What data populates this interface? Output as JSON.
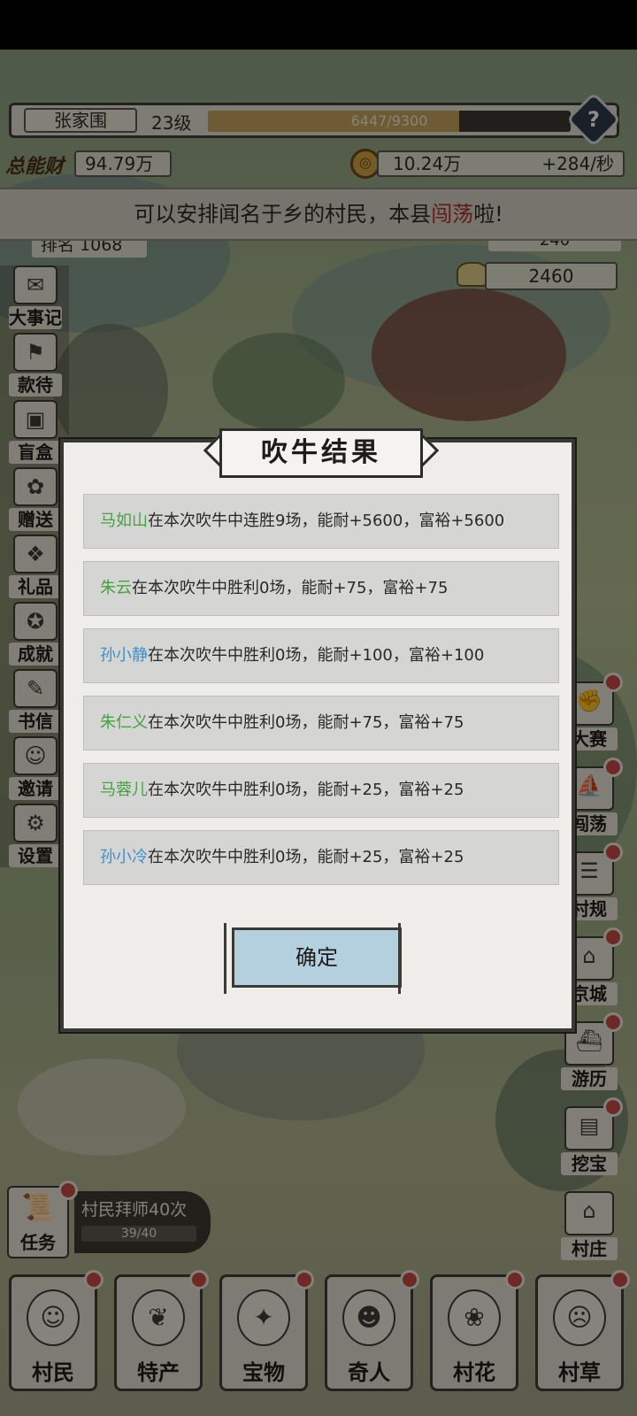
{
  "hud": {
    "village_name": "张家围",
    "level": "23级",
    "xp_text": "6447/9300",
    "xp_progress": 0.693,
    "help_label": "?",
    "power_label": "总能财",
    "power_value": "94.79万",
    "coin_amount": "10.24万",
    "coin_rate": "+284/秒",
    "rank_text": "排名 1068",
    "small_value": "240",
    "ingot_value": "2460"
  },
  "notice": {
    "prefix": "可以安排闻名于乡的村民，本县",
    "highlight": "闯荡",
    "suffix": "啦!"
  },
  "left_menu": [
    {
      "label": "大事记",
      "icon": "scroll-icon"
    },
    {
      "label": "款待",
      "icon": "hospitality-icon"
    },
    {
      "label": "盲盒",
      "icon": "box-icon"
    },
    {
      "label": "赠送",
      "icon": "gift-icon"
    },
    {
      "label": "礼品",
      "icon": "present-icon"
    },
    {
      "label": "成就",
      "icon": "trophy-icon"
    },
    {
      "label": "书信",
      "icon": "letter-icon"
    },
    {
      "label": "邀请",
      "icon": "invite-icon"
    },
    {
      "label": "设置",
      "icon": "gear-icon"
    }
  ],
  "right_menu": [
    {
      "label": "大赛",
      "icon": "contest-icon"
    },
    {
      "label": "闯荡",
      "icon": "adventure-icon"
    },
    {
      "label": "村规",
      "icon": "rules-icon"
    },
    {
      "label": "京城",
      "icon": "capital-icon"
    },
    {
      "label": "游历",
      "icon": "boat-icon"
    },
    {
      "label": "挖宝",
      "icon": "chest-icon"
    },
    {
      "label": "村庄",
      "icon": "village-icon"
    }
  ],
  "modal": {
    "title": "吹牛结果",
    "results": [
      {
        "name": "马如山",
        "name_color": "green",
        "text": "在本次吹牛中连胜9场，能耐+5600，富裕+5600"
      },
      {
        "name": "朱云",
        "name_color": "green",
        "text": "在本次吹牛中胜利0场，能耐+75，富裕+75"
      },
      {
        "name": "孙小静",
        "name_color": "blue",
        "text": "在本次吹牛中胜利0场，能耐+100，富裕+100"
      },
      {
        "name": "朱仁义",
        "name_color": "green",
        "text": "在本次吹牛中胜利0场，能耐+75，富裕+75"
      },
      {
        "name": "马蓉儿",
        "name_color": "green",
        "text": "在本次吹牛中胜利0场，能耐+25，富裕+25"
      },
      {
        "name": "孙小冷",
        "name_color": "blue",
        "text": "在本次吹牛中胜利0场，能耐+25，富裕+25"
      }
    ],
    "confirm_label": "确定"
  },
  "quest": {
    "label": "任务",
    "text": "村民拜师40次",
    "progress_text": "39/40"
  },
  "bottom_tabs": [
    {
      "label": "村民",
      "icon": "villager-icon"
    },
    {
      "label": "特产",
      "icon": "specialty-icon"
    },
    {
      "label": "宝物",
      "icon": "treasure-icon"
    },
    {
      "label": "奇人",
      "icon": "stranger-icon"
    },
    {
      "label": "村花",
      "icon": "belle-icon"
    },
    {
      "label": "村草",
      "icon": "hunk-icon"
    }
  ],
  "colors": {
    "name_green": "#45a243",
    "name_blue": "#3b8fd0",
    "notice_highlight": "#b03228",
    "confirm_bg": "#b4d0de"
  }
}
